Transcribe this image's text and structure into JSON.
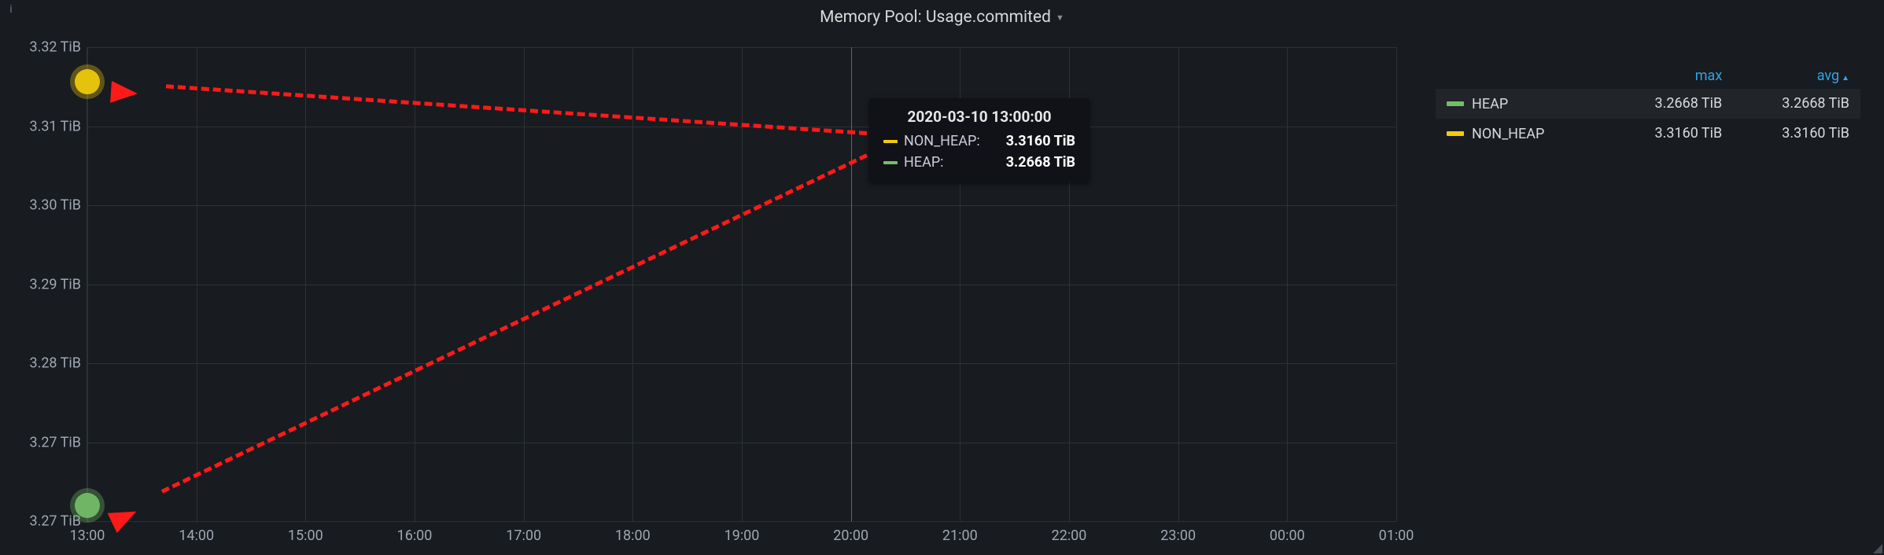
{
  "panel": {
    "title": "Memory Pool: Usage.commited",
    "info_icon": "i"
  },
  "tooltip": {
    "time": "2020-03-10 13:00:00",
    "rows": [
      {
        "label": "NON_HEAP:",
        "value": "3.3160 TiB",
        "color": "#f2cc0c"
      },
      {
        "label": "HEAP:",
        "value": "3.2668 TiB",
        "color": "#73bf69"
      }
    ]
  },
  "legend": {
    "headers": {
      "max": "max",
      "avg": "avg"
    },
    "rows": [
      {
        "name": "HEAP",
        "color": "#73bf69",
        "max": "3.2668 TiB",
        "avg": "3.2668 TiB",
        "highlight": true
      },
      {
        "name": "NON_HEAP",
        "color": "#f2cc0c",
        "max": "3.3160 TiB",
        "avg": "3.3160 TiB",
        "highlight": false
      }
    ]
  },
  "chart_data": {
    "type": "line",
    "title": "Memory Pool: Usage.commited",
    "xlabel": "",
    "ylabel": "",
    "x_ticks": [
      "13:00",
      "14:00",
      "15:00",
      "16:00",
      "17:00",
      "18:00",
      "19:00",
      "20:00",
      "21:00",
      "22:00",
      "23:00",
      "00:00",
      "01:00"
    ],
    "y_ticks": [
      "3.27 TiB",
      "3.27 TiB",
      "3.28 TiB",
      "3.29 TiB",
      "3.30 TiB",
      "3.31 TiB",
      "3.32 TiB"
    ],
    "ylim": [
      3.265,
      3.32
    ],
    "series": [
      {
        "name": "HEAP",
        "color": "#73bf69",
        "x": [
          "13:00"
        ],
        "y": [
          3.2668
        ]
      },
      {
        "name": "NON_HEAP",
        "color": "#f2cc0c",
        "x": [
          "13:00"
        ],
        "y": [
          3.316
        ]
      }
    ],
    "crosshair_x": "20:00",
    "annotations": [
      {
        "type": "arrow",
        "from_near": "tooltip",
        "to_series": "NON_HEAP",
        "to_x": "13:00"
      },
      {
        "type": "arrow",
        "from_near": "tooltip",
        "to_series": "HEAP",
        "to_x": "13:00"
      }
    ]
  }
}
